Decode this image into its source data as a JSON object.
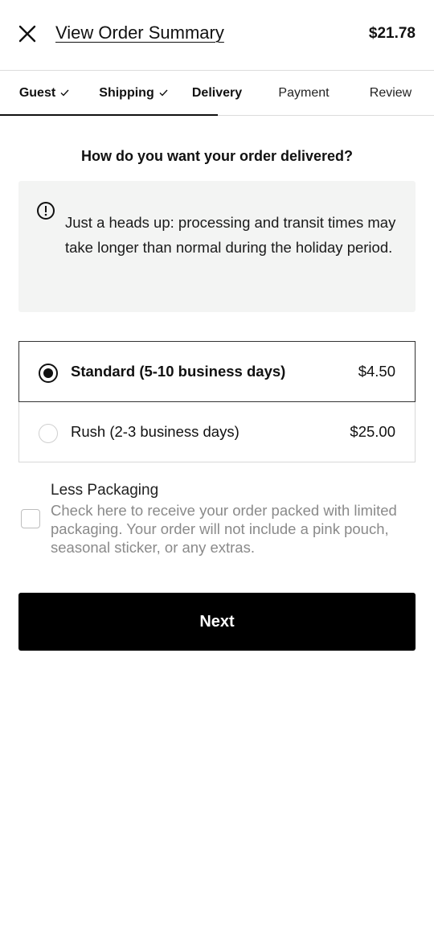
{
  "header": {
    "summary_link": "View Order Summary",
    "order_total": "$21.78"
  },
  "steps": [
    {
      "label": "Guest",
      "status": "done"
    },
    {
      "label": "Shipping",
      "status": "done"
    },
    {
      "label": "Delivery",
      "status": "active"
    },
    {
      "label": "Payment",
      "status": "upcoming"
    },
    {
      "label": "Review",
      "status": "upcoming"
    }
  ],
  "question": "How do you want your order delivered?",
  "notice": {
    "icon": "exclamation-circle-icon",
    "text": "Just a heads up: processing and transit times may take longer than normal during the holiday period."
  },
  "delivery_options": [
    {
      "label": "Standard (5-10 business days)",
      "price": "$4.50",
      "selected": true
    },
    {
      "label": "Rush (2-3 business days)",
      "price": "$25.00",
      "selected": false
    }
  ],
  "less_packaging": {
    "title": "Less Packaging",
    "description": "Check here to receive your order packed with limited packaging. Your order will not include a pink pouch, seasonal sticker, or any extras.",
    "checked": false
  },
  "next_button": "Next"
}
